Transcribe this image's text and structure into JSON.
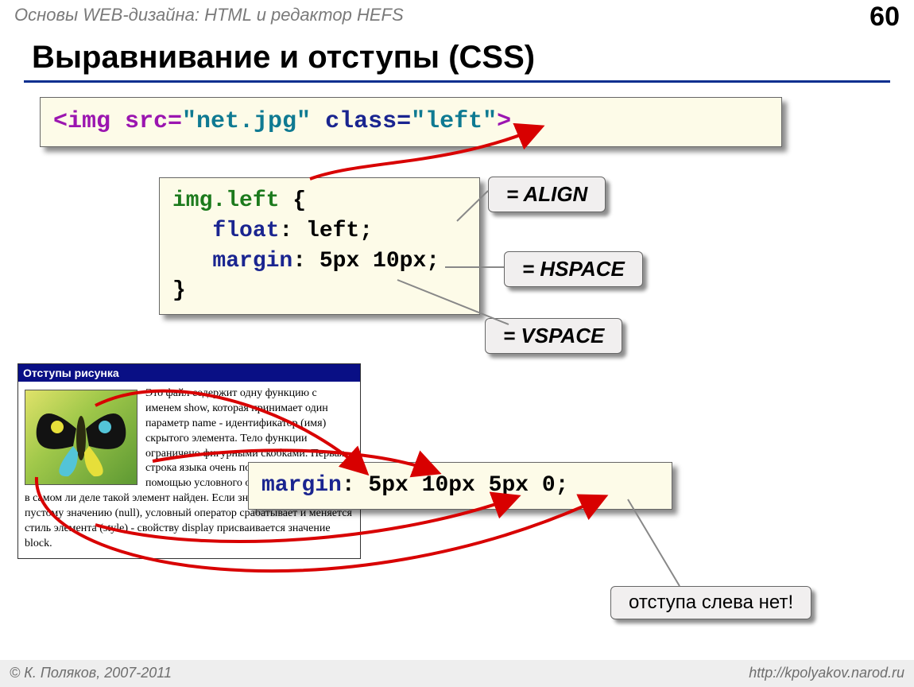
{
  "header": {
    "breadcrumb": "Основы WEB-дизайна: HTML и редактор HEFS",
    "page_number": "60",
    "title": "Выравнивание и отступы (CSS)"
  },
  "code1": {
    "seg1": "<img src=",
    "seg2": "\"net.jpg\" ",
    "seg3": "class=",
    "seg4": "\"left\"",
    "seg5": ">"
  },
  "code2": {
    "line1a": "img.left",
    "line1b": " {",
    "line2a": "   float",
    "line2b": ": left;",
    "line3a": "   margin",
    "line3b": ": 5px 10px;",
    "line4": "}"
  },
  "code3": {
    "a": "margin",
    "b": ": 5px 10px 5px 0;"
  },
  "callouts": {
    "align": "= ALIGN",
    "hspace": "= HSPACE",
    "vspace": "= VSPACE",
    "noleft": "отступа слева нет!"
  },
  "browser": {
    "title": "Отступы рисунка",
    "para": "Это файл содержит одну функцию с именем show, которая принимает один параметр name - идентификатор (имя) скрытого элемента. Тело функции ограничено фигурными скобками. Первая строка языка очень похожа на Паскаль. С помощью условного оператора проверяем, в самом ли деле такой элемент найден. Если значение elem не равно пустому значению (null), условный оператор срабатывает и меняется стиль элемента (style) - свойству display присваивается значение block."
  },
  "footer": {
    "copyright": "© К. Поляков, 2007-2011",
    "url": "http://kpolyakov.narod.ru"
  }
}
